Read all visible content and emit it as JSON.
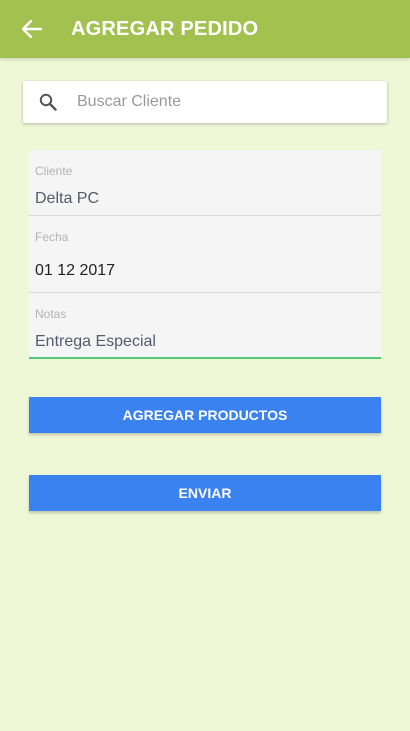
{
  "header": {
    "title": "AGREGAR PEDIDO",
    "back_icon": "arrow-left-icon",
    "background_color": "#a3c14e"
  },
  "search": {
    "icon": "search-icon",
    "placeholder": "Buscar Cliente",
    "value": ""
  },
  "form": {
    "cliente": {
      "label": "Cliente",
      "value": "Delta PC"
    },
    "fecha": {
      "label": "Fecha",
      "value": "01 12 2017"
    },
    "notas": {
      "label": "Notas",
      "value": "Entrega Especial"
    },
    "active_field_color": "#56c875"
  },
  "buttons": {
    "add_products_label": "AGREGAR PRODUCTOS",
    "send_label": "ENVIAR",
    "color": "#3b82f1"
  },
  "page": {
    "background_color": "#eef7d6"
  }
}
